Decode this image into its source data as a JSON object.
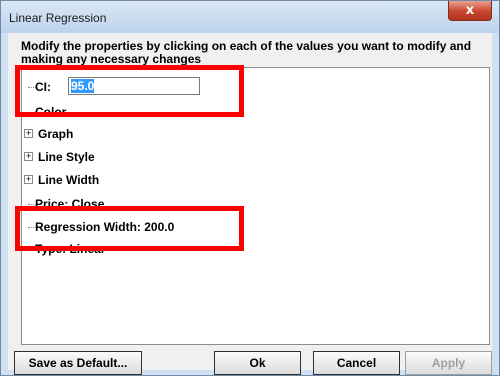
{
  "window": {
    "title": "Linear Regression",
    "close_glyph": "x"
  },
  "instructions": "Modify the properties by clicking on each of the values you want to modify and making any necessary changes",
  "tree": {
    "ci": {
      "label": "CI:",
      "value": "95.0"
    },
    "nodes": [
      {
        "label": "Color",
        "expandable": false
      },
      {
        "label": "Graph",
        "expandable": true
      },
      {
        "label": "Line Style",
        "expandable": true
      },
      {
        "label": "Line Width",
        "expandable": true
      },
      {
        "label": "Price: Close",
        "expandable": false
      },
      {
        "label": "Regression Width: 200.0",
        "expandable": false
      },
      {
        "label": "Type: Linear",
        "expandable": false
      }
    ]
  },
  "buttons": {
    "save_default": "Save as Default...",
    "ok": "Ok",
    "cancel": "Cancel",
    "apply": "Apply"
  },
  "annotation_color": "#ff0000",
  "icons": {
    "expander": "plus-expander-icon",
    "close": "close-icon"
  }
}
